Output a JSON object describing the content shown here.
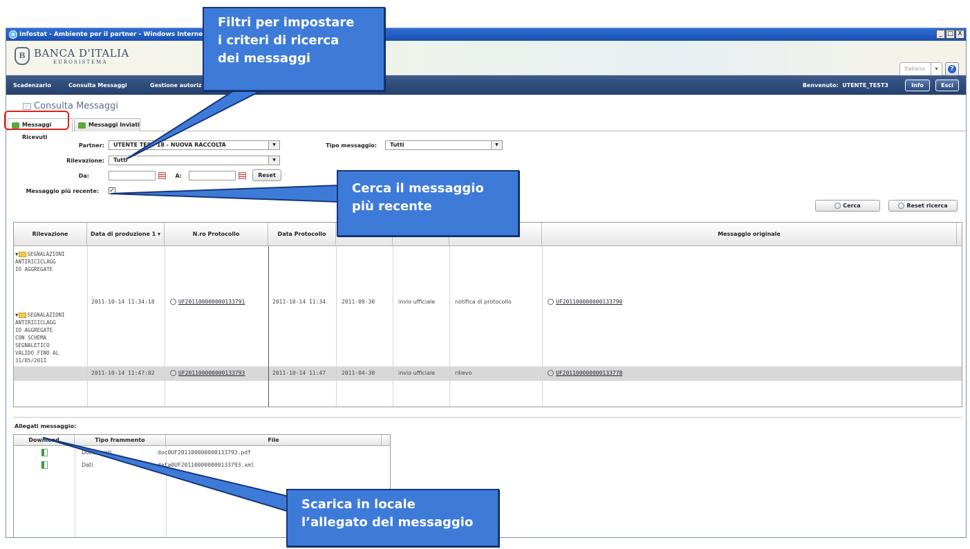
{
  "window": {
    "title": "Infostat - Ambiente per il partner - Windows Internet Explorer",
    "controls": [
      "_",
      "□",
      "X"
    ]
  },
  "header": {
    "logo_main": "BANCA D'ITALIA",
    "logo_sub": "EUROSISTEMA",
    "logo_mark": "B",
    "language": "Italiano"
  },
  "nav": {
    "items": [
      "Scadenzario",
      "Consulta Messaggi",
      "Gestione autoriz"
    ],
    "welcome_label": "Benvenuto:",
    "user": "UTENTE_TEST3",
    "info_label": "Info",
    "exit_label": "Esci"
  },
  "page": {
    "title": "Consulta Messaggi"
  },
  "tabs": [
    "Messaggi Ricevuti",
    "Messaggi Inviati"
  ],
  "filters": {
    "partner_label": "Partner:",
    "partner_value": "UTENTE TEST 18 - NUOVA RACCOLTA",
    "tipo_label": "Tipo messaggio:",
    "tipo_value": "Tutti",
    "rilevazione_label": "Rilevazione:",
    "rilevazione_value": "Tutti",
    "da_label": "Da:",
    "a_label": "A:",
    "reset_label": "Reset",
    "recent_label": "Messaggio più recente:",
    "recent_checked": true,
    "cerca_label": "Cerca",
    "reset_ricerca_label": "Reset ricerca"
  },
  "grid": {
    "columns": [
      "Rilevazione",
      "Data di produzione 1 ▾",
      "N.ro Protocollo",
      "Data Protocollo",
      "",
      "",
      "",
      "Messaggio originale"
    ],
    "groups": [
      {
        "name": "SEGNALAZIONI ANTIRICICLAGGIO AGGREGATE",
        "lines": [
          "SEGNALAZIONI",
          "ANTIRICICLAGG",
          "IO AGGREGATE"
        ]
      },
      {
        "name": "SEGNALAZIONI ANTIRICICLAGGIO AGGREGATE CON SCHEMA SEGNALETICO VALIDO FINO AL 31/05/2011",
        "lines": [
          "SEGNALAZIONI",
          "ANTIRICICLAGG",
          "IO AGGREGATE",
          "CON SCHEMA",
          "SEGNALETICO",
          "VALIDO FINO AL",
          "31/05/2011"
        ]
      }
    ],
    "rows": [
      {
        "data_produzione": "2011-10-14 11:34:18",
        "protocollo": "UF201100000000133791",
        "data_protocollo": "2011-10-14 11:34",
        "riferimento": "2011-09-30",
        "invio": "invio ufficiale",
        "tipo": "notifica di protocollo",
        "originale": "UF201100000000133790"
      },
      {
        "data_produzione": "2011-10-14 11:47:02",
        "protocollo": "UF201100000000133793",
        "data_protocollo": "2011-10-14 11:47",
        "riferimento": "2011-04-30",
        "invio": "invio ufficiale",
        "tipo": "rilievo",
        "originale": "UF201100000000133778"
      }
    ]
  },
  "attachments": {
    "title": "Allegati messaggio:",
    "columns": [
      "Download",
      "Tipo frammento",
      "File"
    ],
    "rows": [
      {
        "tipo": "Documenti",
        "file": "doc0UF201100000000133793.pdf"
      },
      {
        "tipo": "Dati",
        "file": "data0UF201100000000133793.xml"
      }
    ]
  },
  "callouts": {
    "filtri": "Filtri per impostare i criteri di ricerca dei messaggi",
    "filtri_lines": [
      "Filtri per impostare",
      "i criteri di ricerca",
      "dei messaggi"
    ],
    "recente_lines": [
      "Cerca il messaggio",
      "più recente"
    ],
    "scarica_lines": [
      "Scarica in locale",
      "l’allegato del messaggio"
    ]
  },
  "colors": {
    "callout_bg": "#3e7bd9",
    "callout_border": "#17357a",
    "nav_bg": "#24406e",
    "highlight_box": "#e0201a"
  }
}
